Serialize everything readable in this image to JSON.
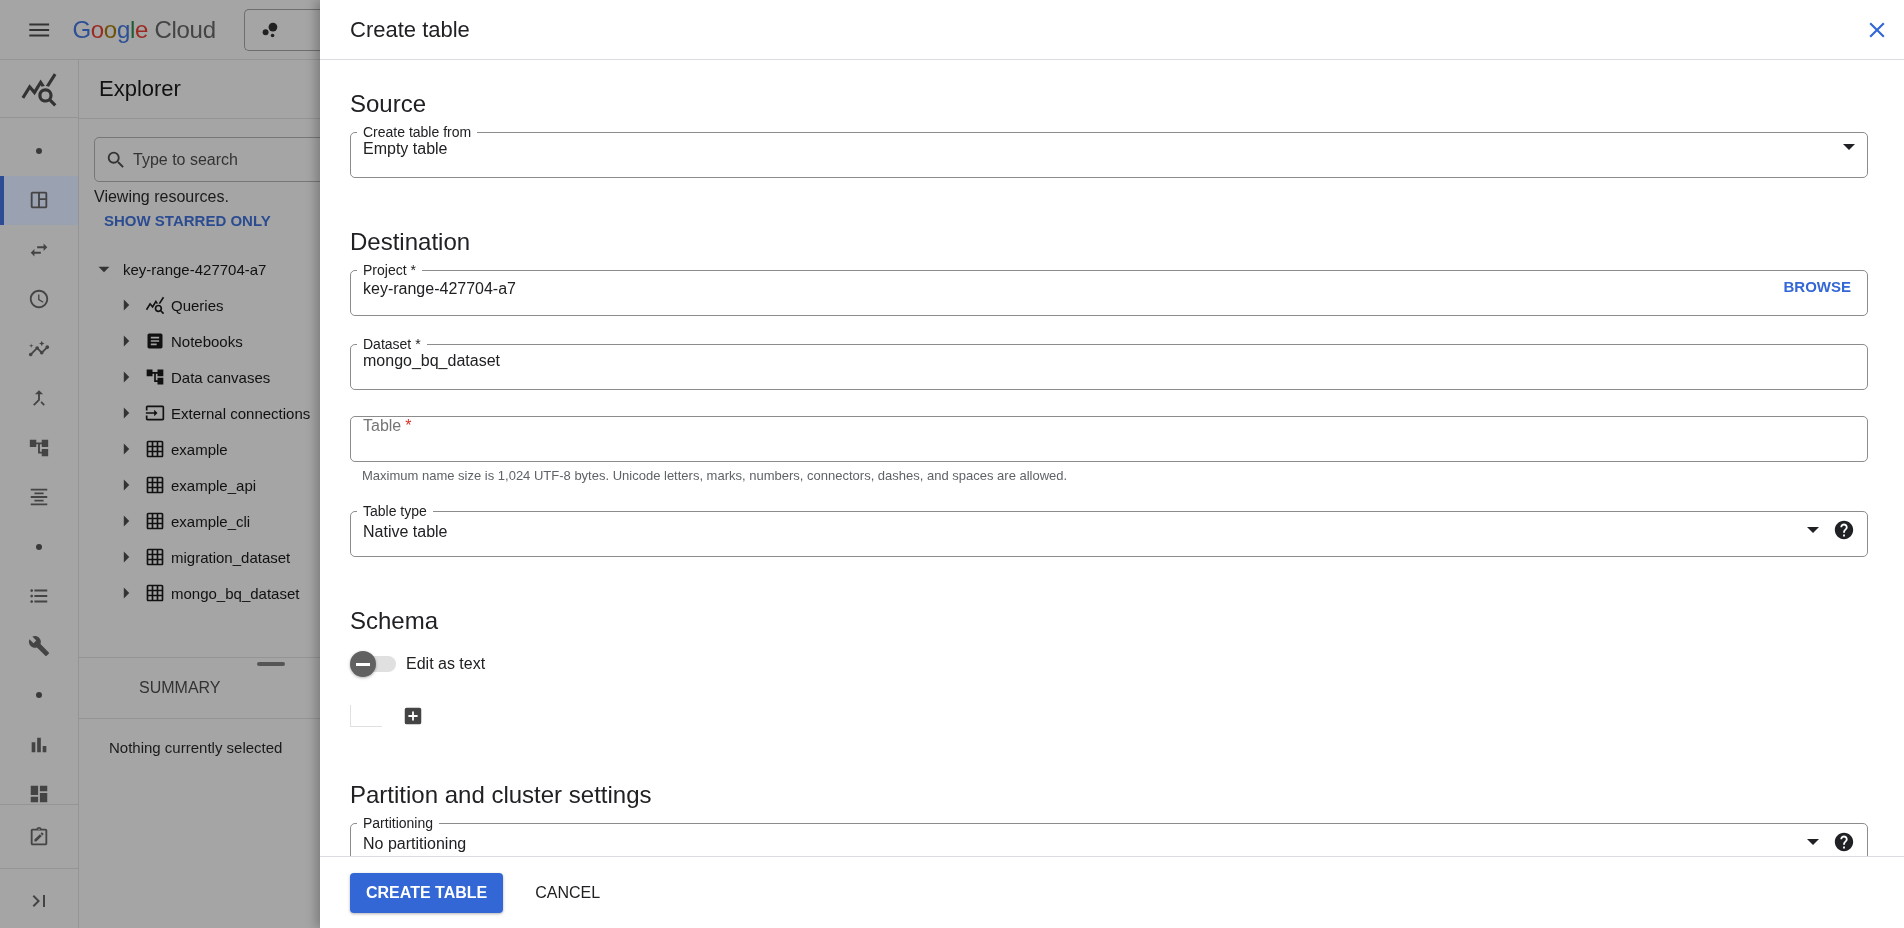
{
  "top_bar": {
    "brand": "Google Cloud"
  },
  "rail": [
    {
      "kind": "dot",
      "selected": false
    },
    {
      "kind": "table",
      "selected": true
    },
    {
      "kind": "swap",
      "selected": false
    },
    {
      "kind": "clock",
      "selected": false
    },
    {
      "kind": "analytics",
      "selected": false
    },
    {
      "kind": "merge",
      "selected": false
    },
    {
      "kind": "tree",
      "selected": false
    },
    {
      "kind": "align",
      "selected": false
    },
    {
      "kind": "dot",
      "selected": false
    },
    {
      "kind": "list",
      "selected": false
    },
    {
      "kind": "wrench",
      "selected": false
    },
    {
      "kind": "dot",
      "selected": false
    },
    {
      "kind": "chart",
      "selected": false
    },
    {
      "kind": "dashboard",
      "selected": false
    }
  ],
  "explorer": {
    "title": "Explorer",
    "search": {
      "placeholder": "Type to search"
    },
    "status": "Viewing resources.",
    "starred_link": "SHOW STARRED ONLY",
    "tree": {
      "label": "key-range-427704-a7",
      "expanded": true,
      "children": [
        {
          "label": "Queries",
          "kind": "queries",
          "expanded": false
        },
        {
          "label": "Notebooks",
          "kind": "notebook",
          "expanded": false
        },
        {
          "label": "Data canvases",
          "kind": "canvas",
          "expanded": false
        },
        {
          "label": "External connections",
          "kind": "connection",
          "expanded": false
        },
        {
          "label": "example",
          "kind": "dataset",
          "expanded": false
        },
        {
          "label": "example_api",
          "kind": "dataset",
          "expanded": false
        },
        {
          "label": "example_cli",
          "kind": "dataset",
          "expanded": false
        },
        {
          "label": "migration_dataset",
          "kind": "dataset",
          "expanded": false
        },
        {
          "label": "mongo_bq_dataset",
          "kind": "dataset",
          "expanded": false
        }
      ]
    },
    "summary_tab": "SUMMARY",
    "summary_text": "Nothing currently selected"
  },
  "drawer": {
    "title": "Create table",
    "sections": [
      {
        "heading": "Source",
        "fields": [
          {
            "kind": "select",
            "label": "Create table from",
            "value": "Empty table"
          }
        ]
      },
      {
        "heading": "Destination",
        "fields": [
          {
            "kind": "action",
            "label": "Project *",
            "value": "key-range-427704-a7",
            "action": "BROWSE"
          },
          {
            "kind": "text",
            "label": "Dataset *",
            "value": "mongo_bq_dataset"
          },
          {
            "kind": "text",
            "placeholder": "Table",
            "required_mark": "*",
            "hint": "Maximum name size is 1,024 UTF-8 bytes. Unicode letters, marks, numbers, connectors, dashes, and spaces are allowed."
          },
          {
            "kind": "select-help",
            "label": "Table type",
            "value": "Native table"
          }
        ]
      },
      {
        "heading": "Schema",
        "toggle": {
          "label": "Edit as text",
          "on": false
        }
      },
      {
        "heading": "Partition and cluster settings",
        "fields": [
          {
            "kind": "select-help",
            "label": "Partitioning",
            "value": "No partitioning"
          }
        ]
      }
    ],
    "buttons": [
      {
        "label": "CREATE TABLE",
        "kind": "primary"
      },
      {
        "label": "CANCEL",
        "kind": "text"
      }
    ]
  }
}
